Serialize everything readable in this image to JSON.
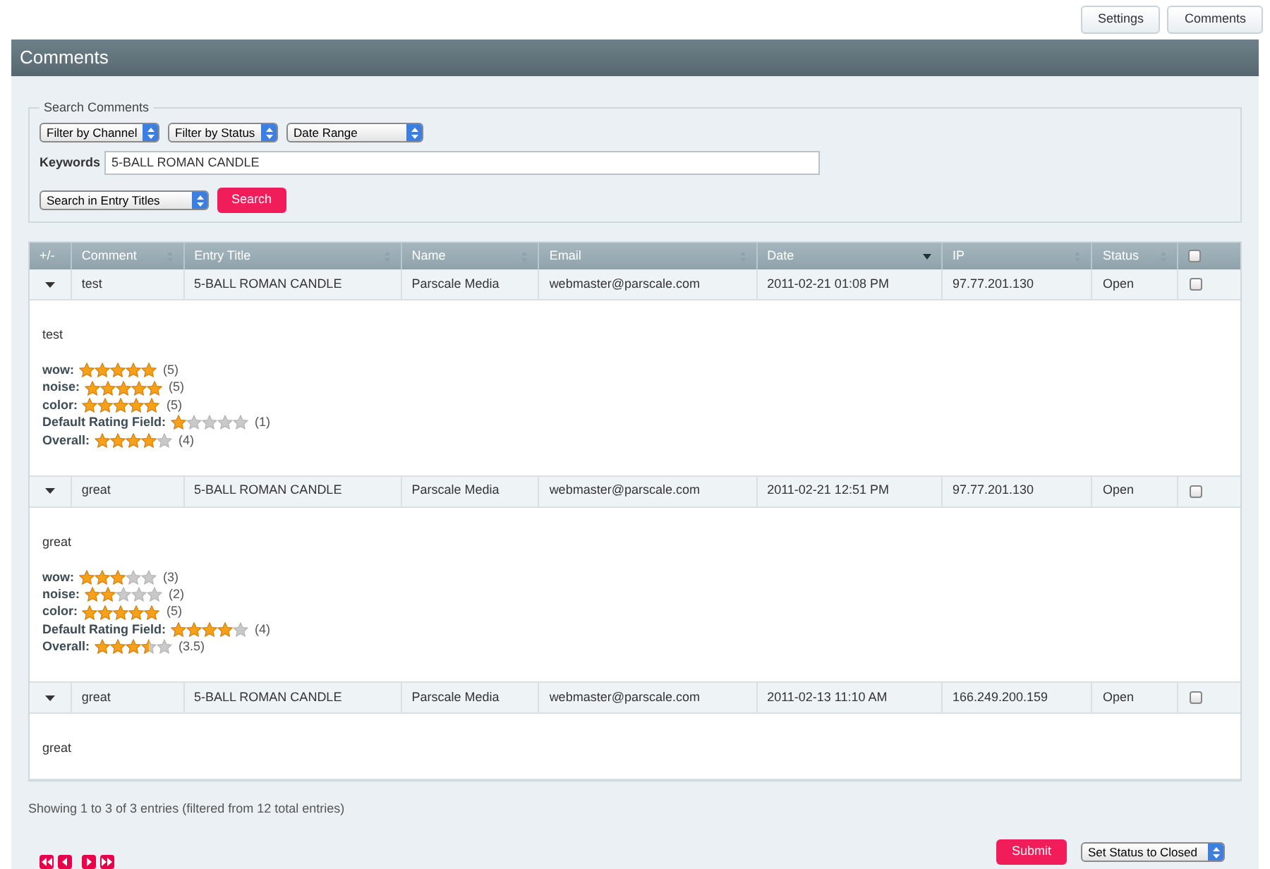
{
  "top_buttons": [
    "Settings",
    "Comments"
  ],
  "header": {
    "title": "Comments"
  },
  "search": {
    "legend": "Search Comments",
    "filters": [
      "Filter by Channel",
      "Filter by Status",
      "Date Range"
    ],
    "keywords_label": "Keywords",
    "keywords_value": "5-BALL ROMAN CANDLE",
    "scope": "Search in Entry Titles",
    "search_button": "Search"
  },
  "table": {
    "header_checked": false,
    "columns": [
      {
        "label": "+/-",
        "sortable": false
      },
      {
        "label": "Comment",
        "sortable": true,
        "sorted": false
      },
      {
        "label": "Entry Title",
        "sortable": true,
        "sorted": false
      },
      {
        "label": "Name",
        "sortable": true,
        "sorted": false
      },
      {
        "label": "Email",
        "sortable": true,
        "sorted": false
      },
      {
        "label": "Date",
        "sortable": true,
        "sorted": true
      },
      {
        "label": "IP",
        "sortable": true,
        "sorted": false
      },
      {
        "label": "Status",
        "sortable": true,
        "sorted": false
      }
    ],
    "rows": [
      {
        "expanded": true,
        "checked": false,
        "cells": [
          "",
          "test",
          "5-BALL ROMAN CANDLE",
          "Parscale Media",
          "webmaster@parscale.com",
          "2011-02-21 01:08 PM",
          "97.77.201.130",
          "Open"
        ],
        "detail": {
          "text": "test",
          "ratings": [
            {
              "label": "wow:",
              "stars": 5,
              "reading": "(5)"
            },
            {
              "label": "noise:",
              "stars": 5,
              "reading": "(5)"
            },
            {
              "label": "color:",
              "stars": 5,
              "reading": "(5)"
            },
            {
              "label": "Default Rating Field:",
              "stars": 1,
              "reading": "(1)"
            },
            {
              "label": "Overall:",
              "stars": 4,
              "reading": "(4)"
            }
          ]
        }
      },
      {
        "expanded": true,
        "checked": false,
        "cells": [
          "",
          "great",
          "5-BALL ROMAN CANDLE",
          "Parscale Media",
          "webmaster@parscale.com",
          "2011-02-21 12:51 PM",
          "97.77.201.130",
          "Open"
        ],
        "detail": {
          "text": "great",
          "ratings": [
            {
              "label": "wow:",
              "stars": 3,
              "reading": "(3)"
            },
            {
              "label": "noise:",
              "stars": 2,
              "reading": "(2)"
            },
            {
              "label": "color:",
              "stars": 5,
              "reading": "(5)"
            },
            {
              "label": "Default Rating Field:",
              "stars": 4,
              "reading": "(4)"
            },
            {
              "label": "Overall:",
              "stars": 3.5,
              "reading": "(3.5)"
            }
          ]
        }
      },
      {
        "expanded": true,
        "checked": false,
        "cells": [
          "",
          "great",
          "5-BALL ROMAN CANDLE",
          "Parscale Media",
          "webmaster@parscale.com",
          "2011-02-13 11:10 AM",
          "166.249.200.159",
          "Open"
        ],
        "detail": {
          "text": "great"
        }
      }
    ]
  },
  "footer": {
    "info": "Showing 1 to 3 of 3 entries (filtered from 12 total entries)",
    "submit": "Submit",
    "action": "Set Status to Closed"
  }
}
